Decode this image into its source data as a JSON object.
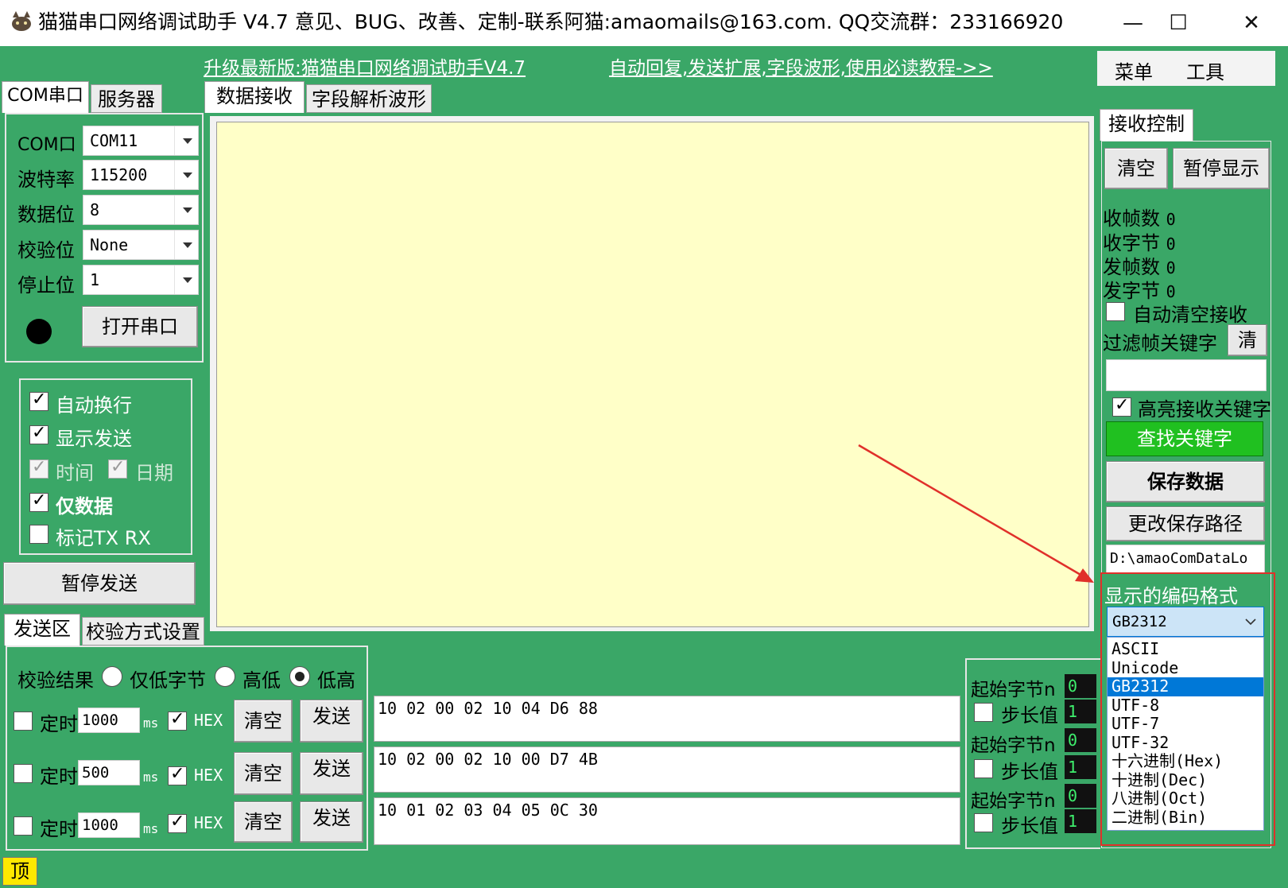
{
  "window": {
    "title": "猫猫串口网络调试助手 V4.7 意见、BUG、改善、定制-联系阿猫:amaomails@163.com. QQ交流群：233166920",
    "min": "—",
    "max": "☐",
    "close": "✕"
  },
  "top_links": {
    "upgrade": "升级最新版:猫猫串口网络调试助手V4.7",
    "tutorial": "自动回复,发送扩展,字段波形,使用必读教程->>"
  },
  "menu": {
    "menu": "菜单",
    "tools": "工具"
  },
  "left_tabs": {
    "com": "COM串口",
    "server": "服务器"
  },
  "serial": {
    "port_label": "COM口",
    "port_value": "COM11",
    "baud_label": "波特率",
    "baud_value": "115200",
    "databits_label": "数据位",
    "databits_value": "8",
    "parity_label": "校验位",
    "parity_value": "None",
    "stopbits_label": "停止位",
    "stopbits_value": "1",
    "open_button": "打开串口"
  },
  "options": {
    "auto_wrap": "自动换行",
    "show_send": "显示发送",
    "time": "时间",
    "date": "日期",
    "data_only": "仅数据",
    "mark_txrx": "标记TX RX"
  },
  "pause_send": "暂停发送",
  "center_tabs": {
    "receive": "数据接收",
    "field": "字段解析波形"
  },
  "send_tabs": {
    "send": "发送区",
    "checksum": "校验方式设置"
  },
  "checksum": {
    "label": "校验结果",
    "low_only": "仅低字节",
    "high_low": "高低",
    "low_high": "低高"
  },
  "send_rows": [
    {
      "timer_label": "定时",
      "interval": "1000",
      "unit": "ms",
      "hex": "HEX",
      "clear": "清空",
      "send": "发送",
      "data": "10 02 00 02 10 04 D6 88"
    },
    {
      "timer_label": "定时",
      "interval": "500",
      "unit": "ms",
      "hex": "HEX",
      "clear": "清空",
      "send": "发送",
      "data": "10 02 00 02 10 00 D7 4B"
    },
    {
      "timer_label": "定时",
      "interval": "1000",
      "unit": "ms",
      "hex": "HEX",
      "clear": "清空",
      "send": "发送",
      "data": "10 01 02 03 04 05 0C 30"
    }
  ],
  "byte_rows": [
    {
      "start_label": "起始字节n",
      "start_value": "0",
      "step_label": "步长值",
      "step_value": "1"
    },
    {
      "start_label": "起始字节n",
      "start_value": "0",
      "step_label": "步长值",
      "step_value": "1"
    },
    {
      "start_label": "起始字节n",
      "start_value": "0",
      "step_label": "步长值",
      "step_value": "1"
    }
  ],
  "top_button": "顶",
  "recv_ctrl": {
    "tab": "接收控制",
    "clear": "清空",
    "pause_display": "暂停显示",
    "rx_frames_label": "收帧数",
    "rx_frames": "0",
    "rx_bytes_label": "收字节",
    "rx_bytes": "0",
    "tx_frames_label": "发帧数",
    "tx_frames": "0",
    "tx_bytes_label": "发字节",
    "tx_bytes": "0",
    "auto_clear": "自动清空接收",
    "filter_label": "过滤帧关键字",
    "filter_clear": "清",
    "filter_value": "",
    "highlight": "高亮接收关键字",
    "find_keyword": "查找关键字",
    "save_data": "保存数据",
    "change_path": "更改保存路径",
    "save_path": "D:\\amaoComDataLo",
    "encoding_label": "显示的编码格式",
    "encoding_selected": "GB2312",
    "encoding_options": [
      "ASCII",
      "Unicode",
      "GB2312",
      "UTF-8",
      "UTF-7",
      "UTF-32",
      "十六进制(Hex)",
      "十进制(Dec)",
      "八进制(Oct)",
      "二进制(Bin)"
    ]
  },
  "colors": {
    "background": "#3aa767",
    "receive_area": "#ffffc8",
    "find_button": "#20c020",
    "highlight_box": "#e0302a",
    "selection": "#0078d7"
  }
}
